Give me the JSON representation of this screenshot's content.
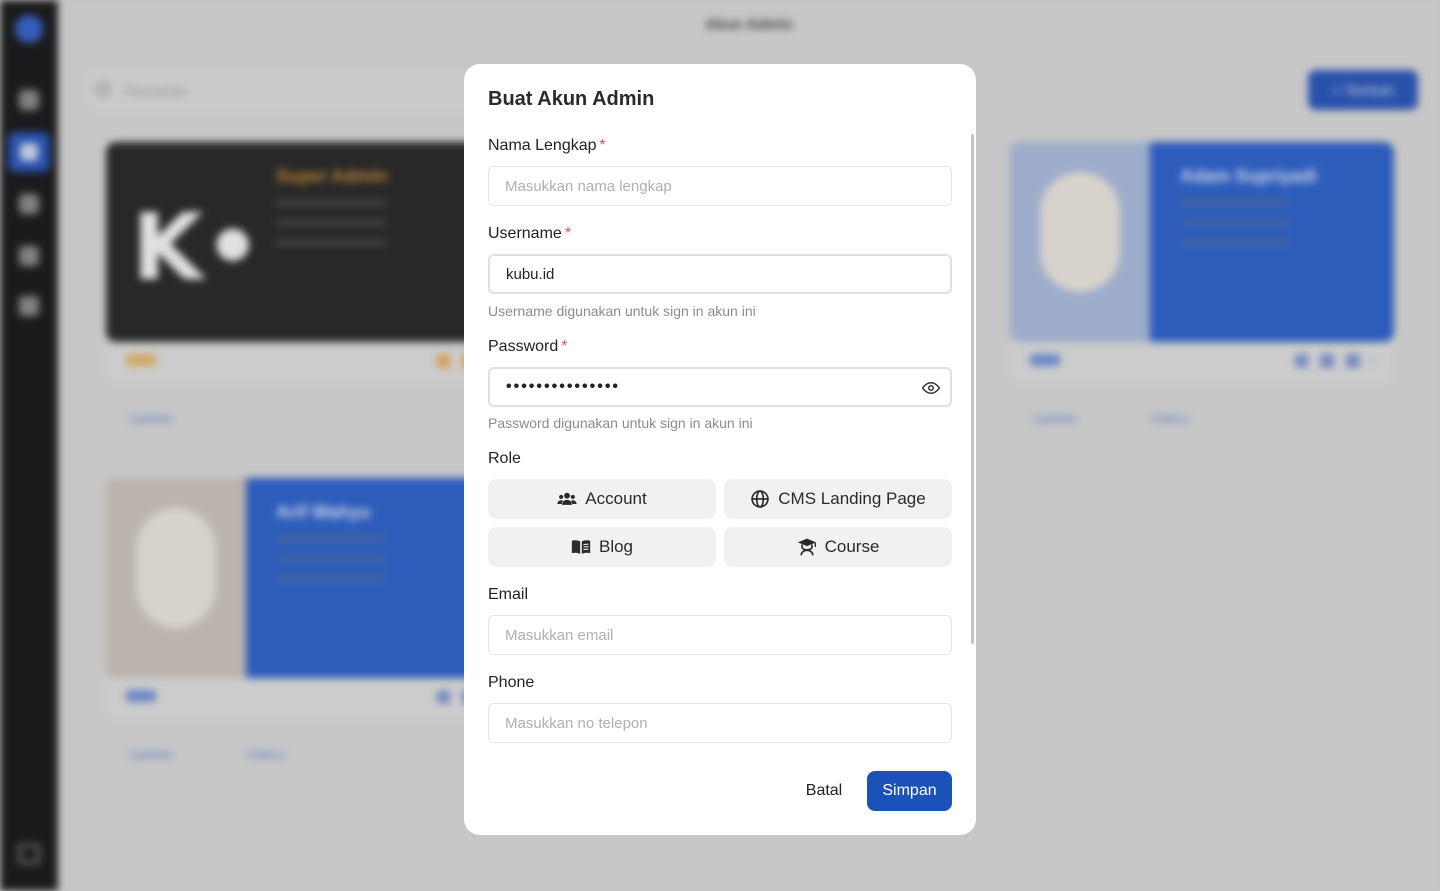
{
  "background": {
    "page_title": "Akun Admin",
    "search_placeholder": "Pencarian",
    "add_button": "+ Tambah",
    "cards": [
      {
        "name": "Super Admin",
        "update_link": "Update"
      },
      {
        "name": "Adam Supriyadi",
        "update_link": "Update",
        "status_link": "Status"
      },
      {
        "name": "Arif Wahyu",
        "update_link": "Update",
        "status_link": "Status"
      }
    ]
  },
  "modal": {
    "title": "Buat Akun Admin",
    "full_name": {
      "label": "Nama Lengkap",
      "required_mark": "*",
      "placeholder": "Masukkan nama lengkap",
      "value": ""
    },
    "username": {
      "label": "Username",
      "required_mark": "*",
      "value": "kubu.id",
      "hint": "Username digunakan untuk sign in akun ini"
    },
    "password": {
      "label": "Password",
      "required_mark": "*",
      "value": "•••••••••••••••",
      "hint": "Password digunakan untuk sign in akun ini"
    },
    "role": {
      "label": "Role",
      "options": [
        {
          "label": "Account",
          "icon": "users-icon"
        },
        {
          "label": "CMS Landing Page",
          "icon": "globe-icon"
        },
        {
          "label": "Blog",
          "icon": "book-icon"
        },
        {
          "label": "Course",
          "icon": "graduation-icon"
        }
      ]
    },
    "email": {
      "label": "Email",
      "placeholder": "Masukkan email",
      "value": ""
    },
    "phone": {
      "label": "Phone",
      "placeholder": "Masukkan no telepon",
      "value": ""
    },
    "cancel_label": "Batal",
    "save_label": "Simpan"
  },
  "colors": {
    "primary": "#1a52b8",
    "required": "#e05252",
    "sidebar": "#1c1c1e"
  }
}
